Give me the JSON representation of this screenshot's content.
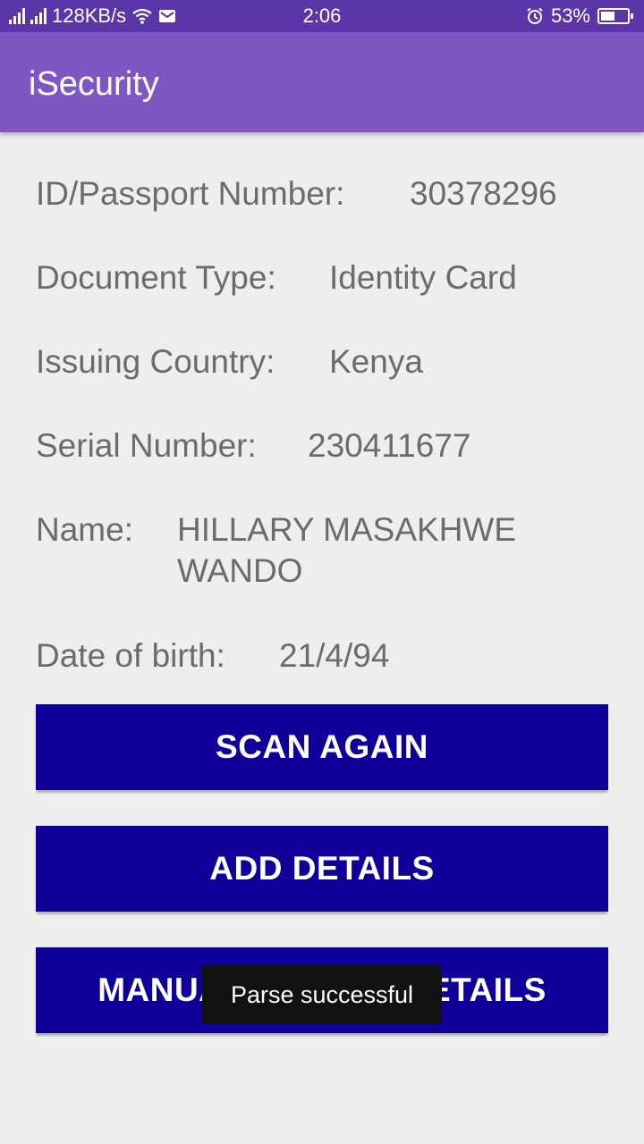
{
  "status_bar": {
    "speed": "128KB/s",
    "time": "2:06",
    "battery": "53%",
    "battery_level": 0.53,
    "icons": [
      "signal-icon",
      "signal-icon",
      "wifi-icon",
      "mail-icon",
      "alarm-icon",
      "battery-icon"
    ]
  },
  "app_bar": {
    "title": "iSecurity"
  },
  "details": {
    "id_label": "ID/Passport Number:",
    "id_value": "30378296",
    "doc_type_label": "Document Type:",
    "doc_type_value": "Identity Card",
    "country_label": "Issuing Country:",
    "country_value": "Kenya",
    "serial_label": "Serial Number:",
    "serial_value": "230411677",
    "name_label": "Name:",
    "name_line1": "HILLARY MASAKHWE",
    "name_line2": "WANDO",
    "dob_label": "Date of birth:",
    "dob_value": "21/4/94"
  },
  "buttons": {
    "scan_again": "SCAN AGAIN",
    "add_details": "ADD DETAILS",
    "manual_input": "MANUALLY INPUT DETAILS"
  },
  "toast": {
    "message": "Parse successful"
  },
  "colors": {
    "status_bar": "#5a36a8",
    "app_bar": "#7e57c2",
    "button": "#10009a",
    "background": "#eeeeee",
    "text": "#6b6b6b"
  }
}
